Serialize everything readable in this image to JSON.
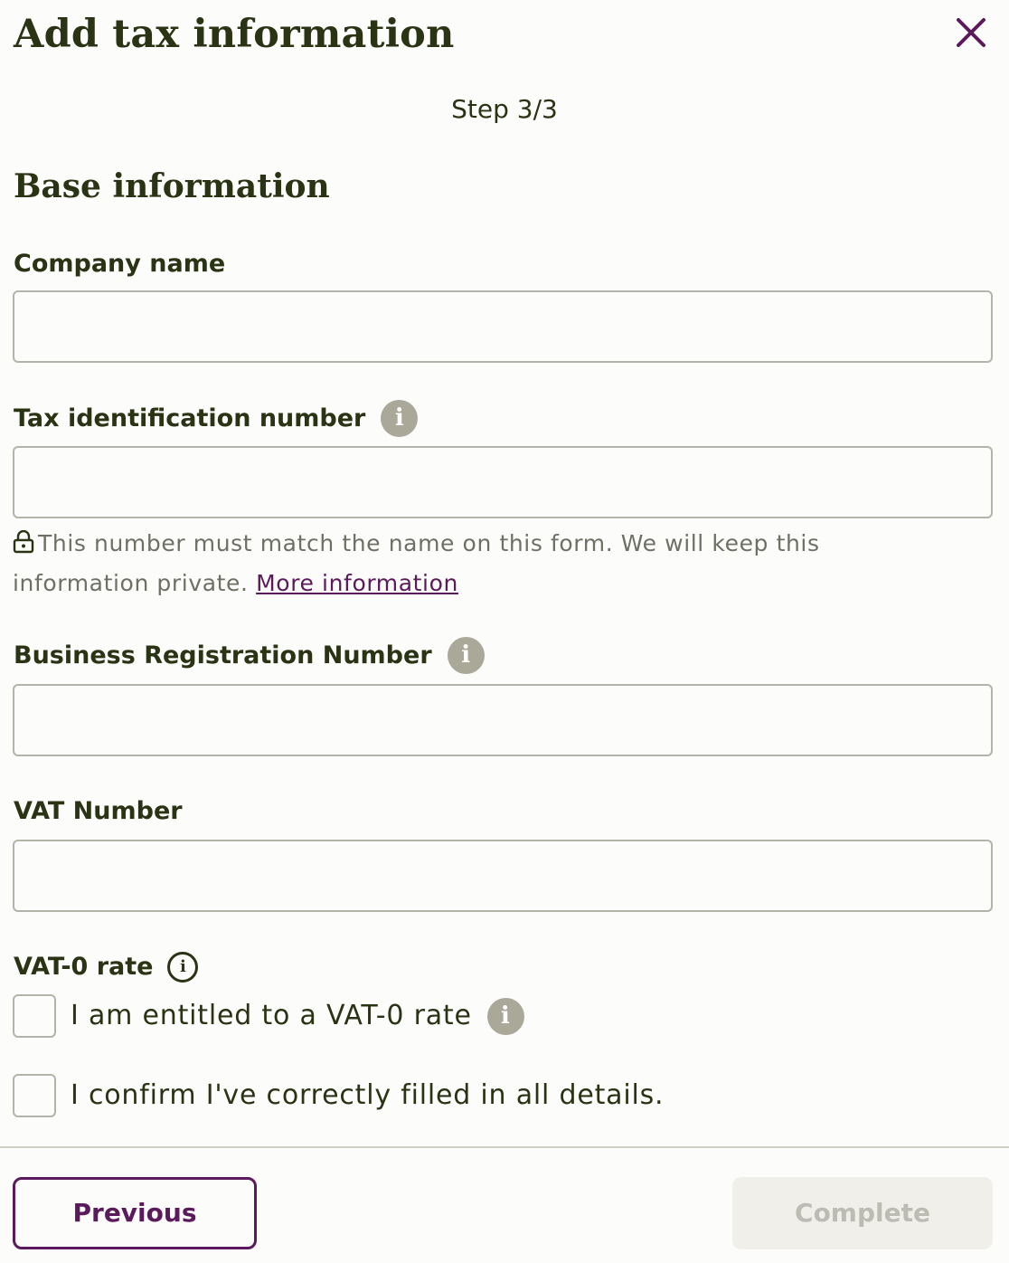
{
  "dialog": {
    "title": "Add tax information",
    "step": "Step 3/3",
    "close_icon": "close-icon"
  },
  "section": {
    "title": "Base information"
  },
  "fields": {
    "company_name": {
      "label": "Company name",
      "value": "",
      "placeholder": ""
    },
    "tax_id": {
      "label": "Tax identification number",
      "value": "",
      "placeholder": "",
      "info_icon": "info-icon"
    },
    "tax_hint": {
      "text": "This number must match the name on this form. We will keep this information private. ",
      "link": "More information",
      "icon": "lock-icon"
    },
    "business_reg": {
      "label": "Business Registration Number",
      "value": "",
      "placeholder": "",
      "info_icon": "info-icon"
    },
    "vat_number": {
      "label": "VAT Number",
      "value": "",
      "placeholder": ""
    },
    "vat0": {
      "label": "VAT-0 rate",
      "info_icon": "info-outline-icon"
    }
  },
  "checkboxes": [
    {
      "label": "I am entitled to a VAT-0 rate",
      "checked": false,
      "info_icon": "info-icon"
    },
    {
      "label": "I confirm I've correctly filled in all details.",
      "checked": false
    }
  ],
  "footer": {
    "previous_label": "Previous",
    "complete_label": "Complete",
    "complete_disabled": true
  },
  "colors": {
    "text": "#2a3314",
    "accent": "#5b1a5c",
    "border": "#b4b3aa",
    "info_icon_bg": "#a9a899",
    "disabled_bg": "#f0efea",
    "disabled_text": "#bdbcb3",
    "muted_text": "#6f6f66"
  }
}
